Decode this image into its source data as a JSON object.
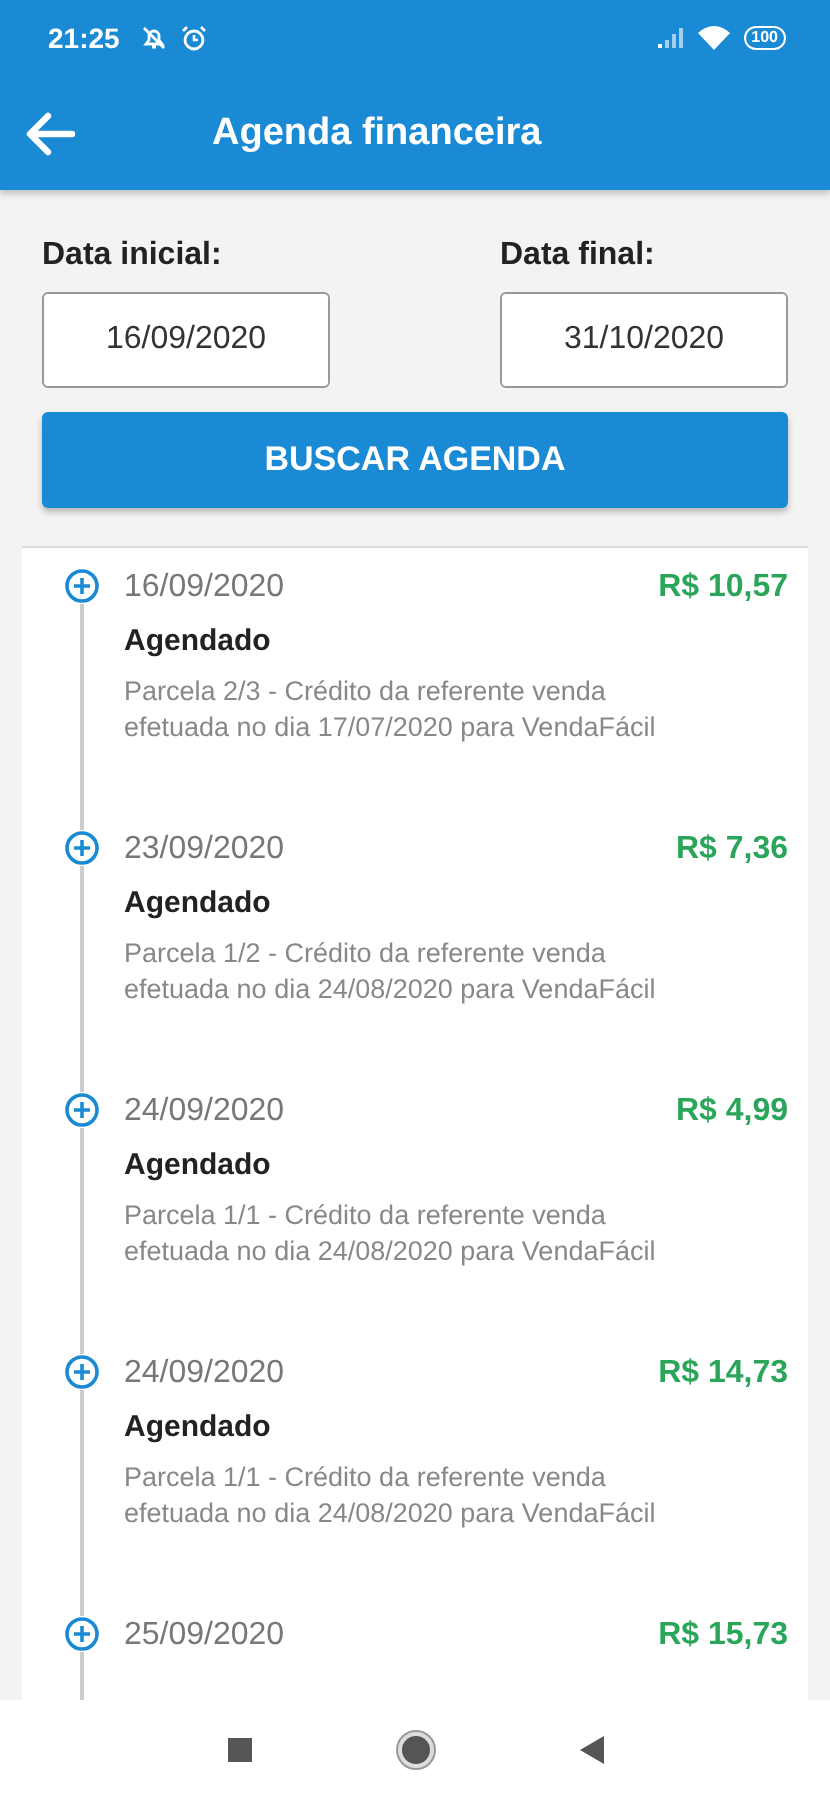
{
  "status_bar": {
    "time": "21:25",
    "battery": "100"
  },
  "header": {
    "title": "Agenda financeira"
  },
  "filters": {
    "start": {
      "label": "Data inicial:",
      "value": "16/09/2020"
    },
    "end": {
      "label": "Data final:",
      "value": "31/10/2020"
    },
    "button": "BUSCAR AGENDA"
  },
  "entries": [
    {
      "date": "16/09/2020",
      "amount": "R$ 10,57",
      "status": "Agendado",
      "description": "Parcela 2/3 - Crédito da referente venda efetuada no dia 17/07/2020 para VendaFácil"
    },
    {
      "date": "23/09/2020",
      "amount": "R$ 7,36",
      "status": "Agendado",
      "description": "Parcela 1/2 - Crédito da referente venda efetuada no dia 24/08/2020 para VendaFácil"
    },
    {
      "date": "24/09/2020",
      "amount": "R$ 4,99",
      "status": "Agendado",
      "description": "Parcela 1/1 - Crédito da referente venda efetuada no dia 24/08/2020 para VendaFácil"
    },
    {
      "date": "24/09/2020",
      "amount": "R$ 14,73",
      "status": "Agendado",
      "description": "Parcela 1/1 - Crédito da referente venda efetuada no dia 24/08/2020 para VendaFácil"
    },
    {
      "date": "25/09/2020",
      "amount": "R$ 15,73"
    }
  ]
}
